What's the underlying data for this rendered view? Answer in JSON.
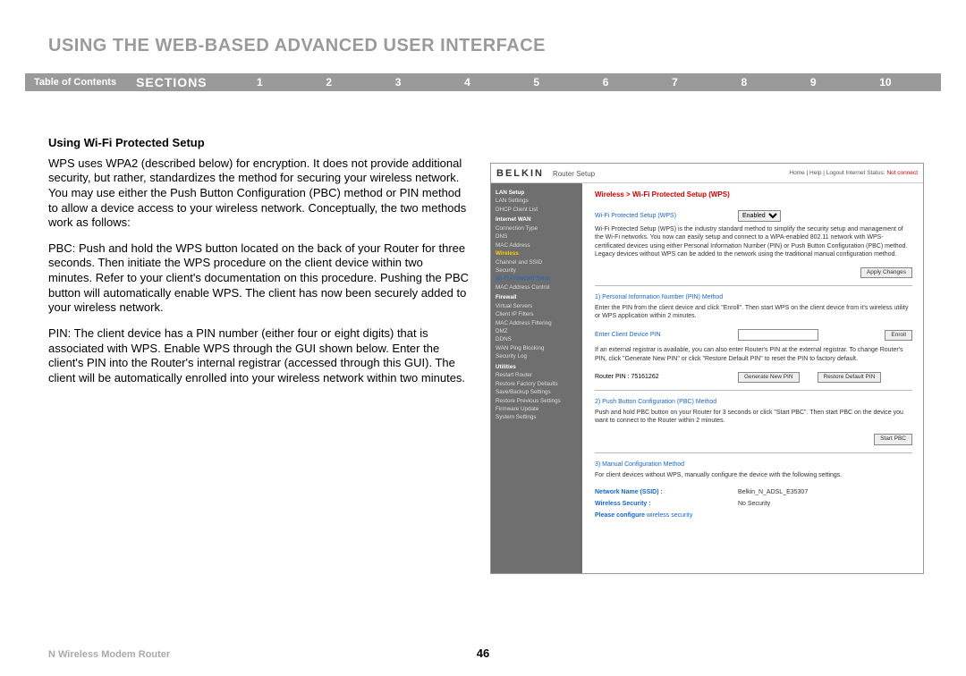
{
  "title": "USING THE WEB-BASED ADVANCED USER INTERFACE",
  "nav": {
    "toc": "Table of Contents",
    "sections": "SECTIONS",
    "nums": [
      "1",
      "2",
      "3",
      "4",
      "5",
      "6",
      "7",
      "8",
      "9",
      "10"
    ],
    "active": "6"
  },
  "content": {
    "heading": "Using Wi-Fi Protected Setup",
    "p1": "WPS uses WPA2 (described below) for encryption. It does not provide additional security, but rather, standardizes the method for securing your wireless network. You may use either the Push Button Configuration (PBC) method or PIN method to allow a device access to your wireless network. Conceptually, the two methods work as follows:",
    "p2": "PBC: Push and hold the WPS button located on the back of your Router for three seconds. Then initiate the WPS procedure on the client device within two minutes. Refer to your client's documentation on this procedure. Pushing the PBC button will automatically enable WPS. The client has now been securely added to your wireless network.",
    "p3": "PIN: The client device has a PIN number (either four or eight digits) that is associated with WPS. Enable WPS through the GUI shown below. Enter the client's PIN into the Router's internal registrar (accessed through this GUI). The client will be automatically enrolled into your wireless network within two minutes."
  },
  "figure": {
    "logo": "BELKIN",
    "router_setup": "Router Setup",
    "toplinks": "Home | Help | Logout  Internet Status:",
    "status": "Not connect",
    "side": {
      "lan": "LAN Setup",
      "lan_items": [
        "LAN Settings",
        "DHCP Client List"
      ],
      "wan": "Internet WAN",
      "wan_items": [
        "Connection Type",
        "DNS",
        "MAC Address"
      ],
      "wireless": "Wireless",
      "wireless_items": [
        "Channel and SSID",
        "Security"
      ],
      "wps_item": "Wi-Fi Protected Setup",
      "mac_ctrl": "MAC Address Control",
      "firewall": "Firewall",
      "fw_items": [
        "Virtual Servers",
        "Client IP Filters",
        "MAC Address Filtering",
        "DMZ",
        "DDNS",
        "WAN Ping Blocking",
        "Security Log"
      ],
      "utilities": "Utilities",
      "ut_items": [
        "Restart Router",
        "Restore Factory Defaults",
        "Save/Backup Settings",
        "Restore Previous Settings",
        "Firmware Update",
        "System Settings"
      ]
    },
    "main": {
      "crumb": "Wireless  >  Wi-Fi Protected Setup (WPS)",
      "wps_label": "Wi-Fi Protected Setup (WPS)",
      "wps_value": "Enabled",
      "desc": "Wi-Fi Protected Setup (WPS) is the industry standard method to simplify the security setup and management of the Wi-Fi networks. You now can easily setup and connect to a WPA-enabled 802.11 network with WPS-certificated devices using either Personal Information Number (PIN) or Push Button Configuration (PBC) method. Legacy devices without WPS can be added to the network using the traditional manual configuration method.",
      "apply": "Apply Changes",
      "m1_head": "1) Personal Information Number (PIN) Method",
      "m1_p1": "Enter the PIN from the client device and click \"Enroll\". Then start WPS on the client device from it's wireless utility or WPS application within 2 minutes.",
      "m1_label": "Enter Client Device PIN",
      "enroll": "Enroll",
      "m1_p2": "If an external registrar is available, you can also enter Router's PIN at the external registrar. To change Router's PIN, click \"Generate New PIN\" or click \"Restore Default PIN\" to reset the PIN to factory default.",
      "router_pin_label": "Router PIN :",
      "router_pin": "75161262",
      "gen_pin": "Generate New PIN",
      "restore_pin": "Restore Default PIN",
      "m2_head": "2) Push Button Configuration (PBC) Method",
      "m2_p": "Push and hold PBC button on your Router for 3 seconds or click \"Start PBC\". Then start PBC on the device you want to connect to the Router within 2 minutes.",
      "start_pbc": "Start PBC",
      "m3_head": "3) Manual Configuration Method",
      "m3_p": "For client devices without WPS, manually configure the device with the following settings.",
      "ssid_label": "Network Name (SSID) :",
      "ssid_value": "Belkin_N_ADSL_E35307",
      "sec_label": "Wireless Security :",
      "sec_value": "No Security",
      "conf_label": "Please configure",
      "conf_link": "wireless security"
    }
  },
  "footer": {
    "product": "N Wireless Modem Router",
    "page": "46"
  }
}
